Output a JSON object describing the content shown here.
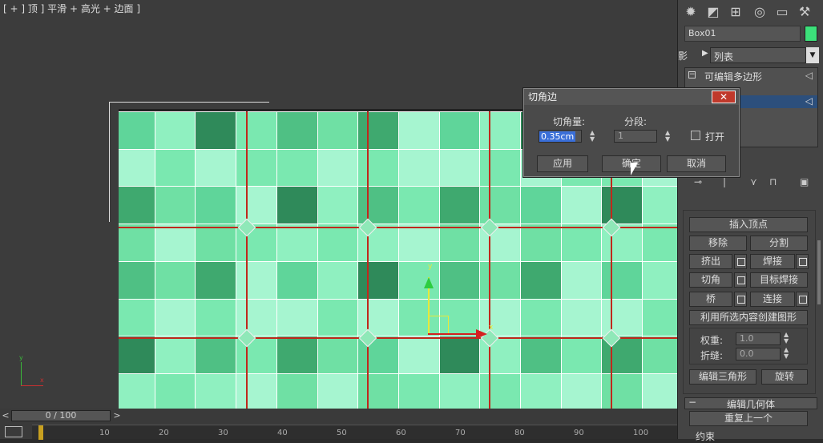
{
  "viewport": {
    "label": "[ + ] 顶 ] 平滑 + 高光 + 边面 ]",
    "axis_x": "x",
    "axis_y": "y"
  },
  "timeline": {
    "frame": "0 / 100",
    "prev": "<",
    "next": ">",
    "ticks": [
      "0",
      "10",
      "20",
      "30",
      "40",
      "50",
      "60",
      "70",
      "80",
      "90",
      "100"
    ]
  },
  "panel": {
    "object_name": "Box01",
    "object_color": "#3ce07a",
    "modifier_list": "修改器列表",
    "modifier_list_visible": "列表",
    "stack_item": "可编辑多边形",
    "buttons": {
      "insert_vertex": "插入顶点",
      "remove": "移除",
      "split": "分割",
      "extrude": "挤出",
      "weld": "焊接",
      "chamfer": "切角",
      "target_weld": "目标焊接",
      "bridge": "桥",
      "connect": "连接",
      "create_shape": "利用所选内容创建图形",
      "edit_tri": "编辑三角形",
      "turn": "旋转",
      "repeat_last": "重复上一个",
      "constraints": "约束"
    },
    "weight_label": "权重:",
    "weight_value": "1.0",
    "crease_label": "折缝:",
    "crease_value": "0.0",
    "edit_geometry": "编辑几何体"
  },
  "dialog": {
    "title": "切角边",
    "amount_label": "切角量:",
    "amount_value": "0.35cm",
    "segments_label": "分段:",
    "segments_value": "1",
    "open_label": "打开",
    "apply": "应用",
    "ok": "确定",
    "cancel": "取消",
    "close": "✕"
  }
}
